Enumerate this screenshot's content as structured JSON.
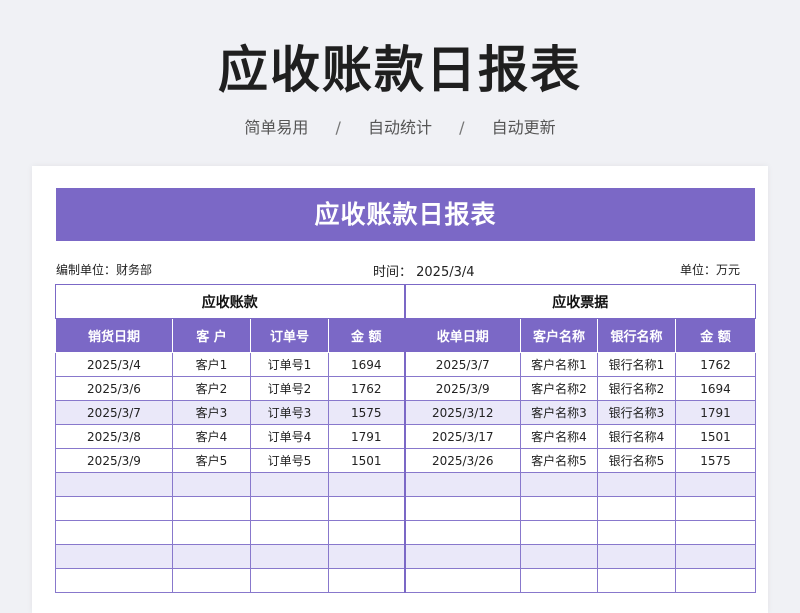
{
  "header": {
    "title": "应收账款日报表",
    "tags": [
      "简单易用",
      "自动统计",
      "自动更新"
    ],
    "separator": "/"
  },
  "sheet": {
    "banner_title": "应收账款日报表",
    "meta": {
      "unit_label": "编制单位：财务部",
      "time_label": "时间：  2025/3/4",
      "currency_label": "单位：万元"
    },
    "sections": {
      "receivables": "应收账款",
      "notes": "应收票据"
    },
    "columns": {
      "left": [
        "销货日期",
        "客  户",
        "订单号",
        "金  额"
      ],
      "right": [
        "收单日期",
        "客户名称",
        "银行名称",
        "金  额"
      ]
    },
    "rows": [
      {
        "l": [
          "2025/3/4",
          "客户1",
          "订单号1",
          "1694"
        ],
        "r": [
          "2025/3/7",
          "客户名称1",
          "银行名称1",
          "1762"
        ]
      },
      {
        "l": [
          "2025/3/6",
          "客户2",
          "订单号2",
          "1762"
        ],
        "r": [
          "2025/3/9",
          "客户名称2",
          "银行名称2",
          "1694"
        ]
      },
      {
        "l": [
          "2025/3/7",
          "客户3",
          "订单号3",
          "1575"
        ],
        "r": [
          "2025/3/12",
          "客户名称3",
          "银行名称3",
          "1791"
        ]
      },
      {
        "l": [
          "2025/3/8",
          "客户4",
          "订单号4",
          "1791"
        ],
        "r": [
          "2025/3/17",
          "客户名称4",
          "银行名称4",
          "1501"
        ]
      },
      {
        "l": [
          "2025/3/9",
          "客户5",
          "订单号5",
          "1501"
        ],
        "r": [
          "2025/3/26",
          "客户名称5",
          "银行名称5",
          "1575"
        ]
      },
      {
        "l": [
          "",
          "",
          "",
          ""
        ],
        "r": [
          "",
          "",
          "",
          ""
        ]
      },
      {
        "l": [
          "",
          "",
          "",
          ""
        ],
        "r": [
          "",
          "",
          "",
          ""
        ]
      },
      {
        "l": [
          "",
          "",
          "",
          ""
        ],
        "r": [
          "",
          "",
          "",
          ""
        ]
      },
      {
        "l": [
          "",
          "",
          "",
          ""
        ],
        "r": [
          "",
          "",
          "",
          ""
        ]
      },
      {
        "l": [
          "",
          "",
          "",
          ""
        ],
        "r": [
          "",
          "",
          "",
          ""
        ]
      }
    ],
    "colors": {
      "accent": "#7b68c6",
      "alt_row": "#eae8f9",
      "background": "#f0f1f5"
    }
  }
}
